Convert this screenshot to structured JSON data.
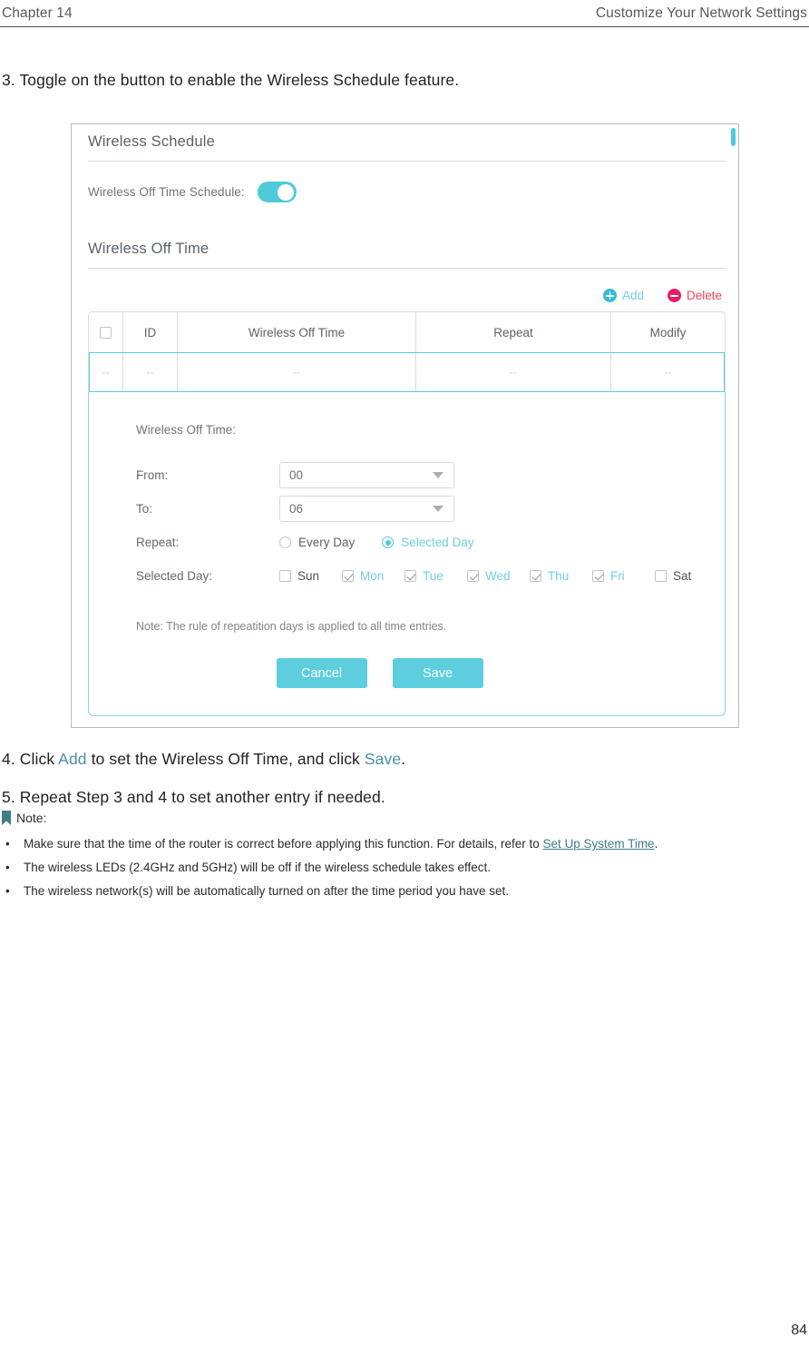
{
  "runhead": {
    "left": "Chapter 14",
    "right": "Customize Your Network Settings"
  },
  "steps": {
    "step3": "3. Toggle on the button to enable the Wireless Schedule feature.",
    "step4_a": "4. Click ",
    "step4_link1": "Add",
    "step4_b": " to set the Wireless Off Time, and click ",
    "step4_link2": "Save",
    "step4_c": ".",
    "step5": "5. Repeat Step 3 and 4 to set another entry if needed."
  },
  "panel": {
    "section1_title": "Wireless Schedule",
    "toggle_label": "Wireless Off Time Schedule:",
    "toggle_state": "on",
    "section2_title": "Wireless Off Time",
    "tools": {
      "add_label": "Add",
      "add_icon": "plus-circle-icon",
      "delete_label": "Delete",
      "delete_icon": "minus-circle-icon"
    },
    "table": {
      "headers": [
        "",
        "ID",
        "Wireless Off Time",
        "Repeat",
        "Modify"
      ],
      "rows": [
        {
          "id": "--",
          "time": "--",
          "repeat": "--",
          "modify": "--"
        }
      ]
    },
    "form": {
      "title": "Wireless Off Time:",
      "from_label": "From:",
      "from_value": "00",
      "to_label": "To:",
      "to_value": "06",
      "repeat_label": "Repeat:",
      "repeat_options": [
        {
          "label": "Every Day",
          "selected": false
        },
        {
          "label": "Selected Day",
          "selected": true
        }
      ],
      "selected_day_label": "Selected Day:",
      "days": [
        {
          "label": "Sun",
          "checked": false
        },
        {
          "label": "Mon",
          "checked": true
        },
        {
          "label": "Tue",
          "checked": true
        },
        {
          "label": "Wed",
          "checked": true
        },
        {
          "label": "Thu",
          "checked": true
        },
        {
          "label": "Fri",
          "checked": true
        },
        {
          "label": "Sat",
          "checked": false
        }
      ],
      "note": "Note: The rule of repeatition days is applied to all time entries.",
      "cancel_label": "Cancel",
      "save_label": "Save"
    }
  },
  "note": {
    "heading": "Note:",
    "bullets": [
      {
        "pre": "Make sure that the time of the router is correct before applying this function. For details, refer to ",
        "link": "Set Up System Time",
        "post": "."
      },
      {
        "pre": "The wireless LEDs (2.4GHz and 5GHz) will be off if the wireless schedule takes effect.",
        "link": "",
        "post": ""
      },
      {
        "pre": "The wireless network(s) will be automatically turned on after the time period you have set.",
        "link": "",
        "post": ""
      }
    ]
  },
  "page_number": "84",
  "colors": {
    "accent": "#4ecadb",
    "link": "#4b8fa6",
    "delete": "#f0425a",
    "note_link": "#3e7d8c"
  }
}
